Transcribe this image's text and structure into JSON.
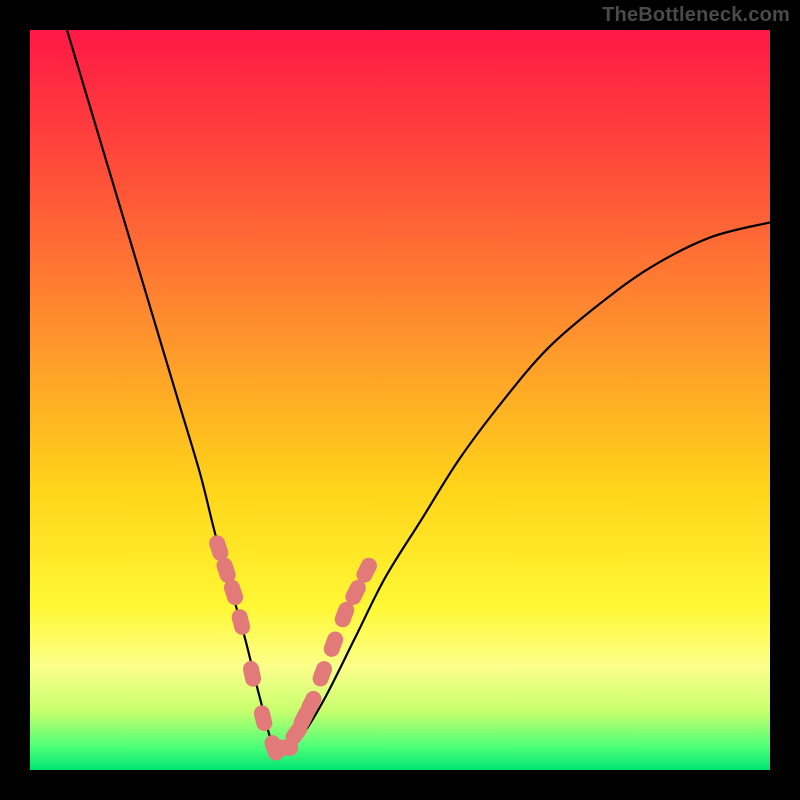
{
  "watermark": "TheBottleneck.com",
  "colors": {
    "background": "#000000",
    "watermark": "#4a4a4a",
    "gradient_stops": [
      {
        "offset": 0.0,
        "color": "#ff1846"
      },
      {
        "offset": 0.18,
        "color": "#ff4a3a"
      },
      {
        "offset": 0.4,
        "color": "#ff8f2e"
      },
      {
        "offset": 0.62,
        "color": "#ffd419"
      },
      {
        "offset": 0.78,
        "color": "#fff835"
      },
      {
        "offset": 0.86,
        "color": "#fcff8a"
      },
      {
        "offset": 0.92,
        "color": "#c8ff6e"
      },
      {
        "offset": 0.97,
        "color": "#4aff78"
      },
      {
        "offset": 1.0,
        "color": "#00e472"
      }
    ],
    "curve": "#000000",
    "markers": "#e27a79"
  },
  "chart_data": {
    "type": "line",
    "title": "",
    "xlabel": "",
    "ylabel": "",
    "xlim": [
      0,
      100
    ],
    "ylim": [
      0,
      100
    ],
    "grid": false,
    "optimum_x": 33,
    "series": [
      {
        "name": "bottleneck-curve",
        "x": [
          5,
          8,
          11,
          14,
          17,
          20,
          23,
          25,
          27,
          29,
          31,
          33,
          35,
          37,
          40,
          44,
          48,
          53,
          58,
          64,
          70,
          77,
          84,
          92,
          100
        ],
        "y": [
          100,
          90,
          80,
          70,
          60,
          50,
          40,
          32,
          25,
          18,
          10,
          3,
          3,
          5,
          10,
          18,
          26,
          34,
          42,
          50,
          57,
          63,
          68,
          72,
          74
        ]
      }
    ],
    "markers": {
      "name": "highlight-points",
      "x": [
        25.5,
        26.5,
        27.5,
        28.5,
        30.0,
        31.5,
        33.0,
        34.5,
        36.0,
        37.0,
        38.0,
        39.5,
        41.0,
        42.5,
        44.0,
        45.5
      ],
      "y": [
        30,
        27,
        24,
        20,
        13,
        7,
        3,
        3,
        5,
        7,
        9,
        13,
        17,
        21,
        24,
        27
      ]
    }
  }
}
